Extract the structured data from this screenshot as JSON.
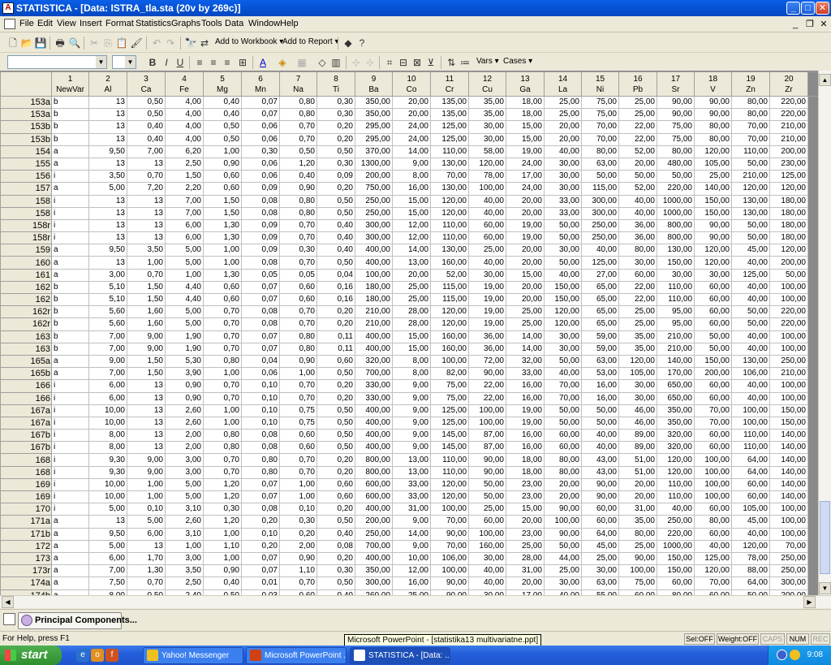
{
  "window": {
    "icon_letter": "A",
    "title": "STATISTICA - [Data: ISTRA_tla.sta (20v by 269c)]",
    "min_glyph": "_",
    "max_glyph": "□",
    "close_glyph": "✕"
  },
  "menu": {
    "items": [
      "File",
      "Edit",
      "View",
      "Insert",
      "Format",
      "Statistics",
      "Graphs",
      "Tools",
      "Data",
      "Window",
      "Help"
    ],
    "mdi_min": "_",
    "mdi_restore": "❐",
    "mdi_close": "✕"
  },
  "toolbar": {
    "add_to_workbook": "Add to Workbook",
    "add_to_report": "Add to Report",
    "vars": "Vars",
    "cases": "Cases",
    "bold": "B",
    "italic": "I",
    "underline": "U"
  },
  "grid": {
    "columns": [
      {
        "num": "1",
        "name": "NewVar"
      },
      {
        "num": "2",
        "name": "Al"
      },
      {
        "num": "3",
        "name": "Ca"
      },
      {
        "num": "4",
        "name": "Fe"
      },
      {
        "num": "5",
        "name": "Mg"
      },
      {
        "num": "6",
        "name": "Mn"
      },
      {
        "num": "7",
        "name": "Na"
      },
      {
        "num": "8",
        "name": "Ti"
      },
      {
        "num": "9",
        "name": "Ba"
      },
      {
        "num": "10",
        "name": "Co"
      },
      {
        "num": "11",
        "name": "Cr"
      },
      {
        "num": "12",
        "name": "Cu"
      },
      {
        "num": "13",
        "name": "Ga"
      },
      {
        "num": "14",
        "name": "La"
      },
      {
        "num": "15",
        "name": "Ni"
      },
      {
        "num": "16",
        "name": "Pb"
      },
      {
        "num": "17",
        "name": "Sr"
      },
      {
        "num": "18",
        "name": "V"
      },
      {
        "num": "19",
        "name": "Zn"
      },
      {
        "num": "20",
        "name": "Zr"
      }
    ],
    "rows": [
      [
        "153a",
        "b",
        "13",
        "0,50",
        "4,00",
        "0,40",
        "0,07",
        "0,80",
        "0,30",
        "350,00",
        "20,00",
        "135,00",
        "35,00",
        "18,00",
        "25,00",
        "75,00",
        "25,00",
        "90,00",
        "90,00",
        "80,00",
        "220,00"
      ],
      [
        "153a",
        "b",
        "13",
        "0,50",
        "4,00",
        "0,40",
        "0,07",
        "0,80",
        "0,30",
        "350,00",
        "20,00",
        "135,00",
        "35,00",
        "18,00",
        "25,00",
        "75,00",
        "25,00",
        "90,00",
        "90,00",
        "80,00",
        "220,00"
      ],
      [
        "153b",
        "b",
        "13",
        "0,40",
        "4,00",
        "0,50",
        "0,06",
        "0,70",
        "0,20",
        "295,00",
        "24,00",
        "125,00",
        "30,00",
        "15,00",
        "20,00",
        "70,00",
        "22,00",
        "75,00",
        "80,00",
        "70,00",
        "210,00"
      ],
      [
        "153b",
        "b",
        "13",
        "0,40",
        "4,00",
        "0,50",
        "0,06",
        "0,70",
        "0,20",
        "295,00",
        "24,00",
        "125,00",
        "30,00",
        "15,00",
        "20,00",
        "70,00",
        "22,00",
        "75,00",
        "80,00",
        "70,00",
        "210,00"
      ],
      [
        "154",
        "a",
        "9,50",
        "7,00",
        "6,20",
        "1,00",
        "0,30",
        "0,50",
        "0,50",
        "370,00",
        "14,00",
        "110,00",
        "58,00",
        "19,00",
        "40,00",
        "80,00",
        "52,00",
        "80,00",
        "120,00",
        "110,00",
        "200,00"
      ],
      [
        "155",
        "a",
        "13",
        "13",
        "2,50",
        "0,90",
        "0,06",
        "1,20",
        "0,30",
        "1300,00",
        "9,00",
        "130,00",
        "120,00",
        "24,00",
        "30,00",
        "63,00",
        "20,00",
        "480,00",
        "105,00",
        "50,00",
        "230,00"
      ],
      [
        "156",
        "i",
        "3,50",
        "0,70",
        "1,50",
        "0,60",
        "0,06",
        "0,40",
        "0,09",
        "200,00",
        "8,00",
        "70,00",
        "78,00",
        "17,00",
        "30,00",
        "50,00",
        "50,00",
        "50,00",
        "25,00",
        "210,00",
        "125,00"
      ],
      [
        "157",
        "a",
        "5,00",
        "7,20",
        "2,20",
        "0,60",
        "0,09",
        "0,90",
        "0,20",
        "750,00",
        "16,00",
        "130,00",
        "100,00",
        "24,00",
        "30,00",
        "115,00",
        "52,00",
        "220,00",
        "140,00",
        "120,00",
        "120,00"
      ],
      [
        "158",
        "i",
        "13",
        "13",
        "7,00",
        "1,50",
        "0,08",
        "0,80",
        "0,50",
        "250,00",
        "15,00",
        "120,00",
        "40,00",
        "20,00",
        "33,00",
        "300,00",
        "40,00",
        "1000,00",
        "150,00",
        "130,00",
        "180,00"
      ],
      [
        "158",
        "i",
        "13",
        "13",
        "7,00",
        "1,50",
        "0,08",
        "0,80",
        "0,50",
        "250,00",
        "15,00",
        "120,00",
        "40,00",
        "20,00",
        "33,00",
        "300,00",
        "40,00",
        "1000,00",
        "150,00",
        "130,00",
        "180,00"
      ],
      [
        "158r",
        "i",
        "13",
        "13",
        "6,00",
        "1,30",
        "0,09",
        "0,70",
        "0,40",
        "300,00",
        "12,00",
        "110,00",
        "60,00",
        "19,00",
        "50,00",
        "250,00",
        "36,00",
        "800,00",
        "90,00",
        "50,00",
        "180,00"
      ],
      [
        "158r",
        "i",
        "13",
        "13",
        "6,00",
        "1,30",
        "0,09",
        "0,70",
        "0,40",
        "300,00",
        "12,00",
        "110,00",
        "60,00",
        "19,00",
        "50,00",
        "250,00",
        "36,00",
        "800,00",
        "90,00",
        "50,00",
        "180,00"
      ],
      [
        "159",
        "a",
        "9,50",
        "3,50",
        "5,00",
        "1,00",
        "0,09",
        "0,30",
        "0,40",
        "400,00",
        "14,00",
        "130,00",
        "25,00",
        "20,00",
        "30,00",
        "40,00",
        "80,00",
        "130,00",
        "120,00",
        "45,00",
        "120,00"
      ],
      [
        "160",
        "a",
        "13",
        "1,00",
        "5,00",
        "1,00",
        "0,08",
        "0,70",
        "0,50",
        "400,00",
        "13,00",
        "160,00",
        "40,00",
        "20,00",
        "50,00",
        "125,00",
        "30,00",
        "150,00",
        "120,00",
        "40,00",
        "200,00"
      ],
      [
        "161",
        "a",
        "3,00",
        "0,70",
        "1,00",
        "1,30",
        "0,05",
        "0,05",
        "0,04",
        "100,00",
        "20,00",
        "52,00",
        "30,00",
        "15,00",
        "40,00",
        "27,00",
        "60,00",
        "30,00",
        "30,00",
        "125,00",
        "50,00"
      ],
      [
        "162",
        "b",
        "5,10",
        "1,50",
        "4,40",
        "0,60",
        "0,07",
        "0,60",
        "0,16",
        "180,00",
        "25,00",
        "115,00",
        "19,00",
        "20,00",
        "150,00",
        "65,00",
        "22,00",
        "110,00",
        "60,00",
        "40,00",
        "100,00"
      ],
      [
        "162",
        "b",
        "5,10",
        "1,50",
        "4,40",
        "0,60",
        "0,07",
        "0,60",
        "0,16",
        "180,00",
        "25,00",
        "115,00",
        "19,00",
        "20,00",
        "150,00",
        "65,00",
        "22,00",
        "110,00",
        "60,00",
        "40,00",
        "100,00"
      ],
      [
        "162r",
        "b",
        "5,60",
        "1,60",
        "5,00",
        "0,70",
        "0,08",
        "0,70",
        "0,20",
        "210,00",
        "28,00",
        "120,00",
        "19,00",
        "25,00",
        "120,00",
        "65,00",
        "25,00",
        "95,00",
        "60,00",
        "50,00",
        "220,00"
      ],
      [
        "162r",
        "b",
        "5,60",
        "1,60",
        "5,00",
        "0,70",
        "0,08",
        "0,70",
        "0,20",
        "210,00",
        "28,00",
        "120,00",
        "19,00",
        "25,00",
        "120,00",
        "65,00",
        "25,00",
        "95,00",
        "60,00",
        "50,00",
        "220,00"
      ],
      [
        "163",
        "b",
        "7,00",
        "9,00",
        "1,90",
        "0,70",
        "0,07",
        "0,80",
        "0,11",
        "400,00",
        "15,00",
        "160,00",
        "36,00",
        "14,00",
        "30,00",
        "59,00",
        "35,00",
        "210,00",
        "50,00",
        "40,00",
        "100,00"
      ],
      [
        "163",
        "b",
        "7,00",
        "9,00",
        "1,90",
        "0,70",
        "0,07",
        "0,80",
        "0,11",
        "400,00",
        "15,00",
        "160,00",
        "36,00",
        "14,00",
        "30,00",
        "59,00",
        "35,00",
        "210,00",
        "50,00",
        "40,00",
        "100,00"
      ],
      [
        "165a",
        "a",
        "9,00",
        "1,50",
        "5,30",
        "0,80",
        "0,04",
        "0,90",
        "0,60",
        "320,00",
        "8,00",
        "100,00",
        "72,00",
        "32,00",
        "50,00",
        "63,00",
        "120,00",
        "140,00",
        "150,00",
        "130,00",
        "250,00"
      ],
      [
        "165b",
        "a",
        "7,00",
        "1,50",
        "3,90",
        "1,00",
        "0,06",
        "1,00",
        "0,50",
        "700,00",
        "8,00",
        "82,00",
        "90,00",
        "33,00",
        "40,00",
        "53,00",
        "105,00",
        "170,00",
        "200,00",
        "106,00",
        "210,00"
      ],
      [
        "166",
        "i",
        "6,00",
        "13",
        "0,90",
        "0,70",
        "0,10",
        "0,70",
        "0,20",
        "330,00",
        "9,00",
        "75,00",
        "22,00",
        "16,00",
        "70,00",
        "16,00",
        "30,00",
        "650,00",
        "60,00",
        "40,00",
        "100,00"
      ],
      [
        "166",
        "i",
        "6,00",
        "13",
        "0,90",
        "0,70",
        "0,10",
        "0,70",
        "0,20",
        "330,00",
        "9,00",
        "75,00",
        "22,00",
        "16,00",
        "70,00",
        "16,00",
        "30,00",
        "650,00",
        "60,00",
        "40,00",
        "100,00"
      ],
      [
        "167a",
        "i",
        "10,00",
        "13",
        "2,60",
        "1,00",
        "0,10",
        "0,75",
        "0,50",
        "400,00",
        "9,00",
        "125,00",
        "100,00",
        "19,00",
        "50,00",
        "50,00",
        "46,00",
        "350,00",
        "70,00",
        "100,00",
        "150,00"
      ],
      [
        "167a",
        "i",
        "10,00",
        "13",
        "2,60",
        "1,00",
        "0,10",
        "0,75",
        "0,50",
        "400,00",
        "9,00",
        "125,00",
        "100,00",
        "19,00",
        "50,00",
        "50,00",
        "46,00",
        "350,00",
        "70,00",
        "100,00",
        "150,00"
      ],
      [
        "167b",
        "i",
        "8,00",
        "13",
        "2,00",
        "0,80",
        "0,08",
        "0,60",
        "0,50",
        "400,00",
        "9,00",
        "145,00",
        "87,00",
        "16,00",
        "60,00",
        "40,00",
        "89,00",
        "320,00",
        "60,00",
        "110,00",
        "140,00"
      ],
      [
        "167b",
        "i",
        "8,00",
        "13",
        "2,00",
        "0,80",
        "0,08",
        "0,60",
        "0,50",
        "400,00",
        "9,00",
        "145,00",
        "87,00",
        "16,00",
        "60,00",
        "40,00",
        "89,00",
        "320,00",
        "60,00",
        "110,00",
        "140,00"
      ],
      [
        "168",
        "i",
        "9,30",
        "9,00",
        "3,00",
        "0,70",
        "0,80",
        "0,70",
        "0,20",
        "800,00",
        "13,00",
        "110,00",
        "90,00",
        "18,00",
        "80,00",
        "43,00",
        "51,00",
        "120,00",
        "100,00",
        "64,00",
        "140,00"
      ],
      [
        "168",
        "i",
        "9,30",
        "9,00",
        "3,00",
        "0,70",
        "0,80",
        "0,70",
        "0,20",
        "800,00",
        "13,00",
        "110,00",
        "90,00",
        "18,00",
        "80,00",
        "43,00",
        "51,00",
        "120,00",
        "100,00",
        "64,00",
        "140,00"
      ],
      [
        "169",
        "i",
        "10,00",
        "1,00",
        "5,00",
        "1,20",
        "0,07",
        "1,00",
        "0,60",
        "600,00",
        "33,00",
        "120,00",
        "50,00",
        "23,00",
        "20,00",
        "90,00",
        "20,00",
        "110,00",
        "100,00",
        "60,00",
        "140,00"
      ],
      [
        "169",
        "i",
        "10,00",
        "1,00",
        "5,00",
        "1,20",
        "0,07",
        "1,00",
        "0,60",
        "600,00",
        "33,00",
        "120,00",
        "50,00",
        "23,00",
        "20,00",
        "90,00",
        "20,00",
        "110,00",
        "100,00",
        "60,00",
        "140,00"
      ],
      [
        "170",
        "i",
        "5,00",
        "0,10",
        "3,10",
        "0,30",
        "0,08",
        "0,10",
        "0,20",
        "400,00",
        "31,00",
        "100,00",
        "25,00",
        "15,00",
        "90,00",
        "60,00",
        "31,00",
        "40,00",
        "60,00",
        "105,00",
        "100,00"
      ],
      [
        "171a",
        "a",
        "13",
        "5,00",
        "2,60",
        "1,20",
        "0,20",
        "0,30",
        "0,50",
        "200,00",
        "9,00",
        "70,00",
        "60,00",
        "20,00",
        "100,00",
        "60,00",
        "35,00",
        "250,00",
        "80,00",
        "45,00",
        "100,00"
      ],
      [
        "171b",
        "a",
        "9,50",
        "6,00",
        "3,10",
        "1,00",
        "0,10",
        "0,20",
        "0,40",
        "250,00",
        "14,00",
        "90,00",
        "100,00",
        "23,00",
        "90,00",
        "64,00",
        "80,00",
        "220,00",
        "60,00",
        "40,00",
        "100,00"
      ],
      [
        "172",
        "a",
        "5,00",
        "13",
        "1,00",
        "1,10",
        "0,20",
        "2,00",
        "0,08",
        "700,00",
        "9,00",
        "70,00",
        "160,00",
        "25,00",
        "50,00",
        "45,00",
        "25,00",
        "1000,00",
        "40,00",
        "120,00",
        "70,00"
      ],
      [
        "173",
        "a",
        "6,00",
        "1,70",
        "3,00",
        "1,00",
        "0,07",
        "0,90",
        "0,20",
        "400,00",
        "10,00",
        "106,00",
        "30,00",
        "28,00",
        "44,00",
        "25,00",
        "90,00",
        "150,00",
        "125,00",
        "78,00",
        "250,00"
      ],
      [
        "173r",
        "a",
        "7,00",
        "1,30",
        "3,50",
        "0,90",
        "0,07",
        "1,10",
        "0,30",
        "350,00",
        "12,00",
        "100,00",
        "40,00",
        "31,00",
        "25,00",
        "30,00",
        "100,00",
        "150,00",
        "120,00",
        "88,00",
        "250,00"
      ],
      [
        "174a",
        "a",
        "7,50",
        "0,70",
        "2,50",
        "0,40",
        "0,01",
        "0,70",
        "0,50",
        "300,00",
        "16,00",
        "90,00",
        "40,00",
        "20,00",
        "30,00",
        "63,00",
        "75,00",
        "60,00",
        "70,00",
        "64,00",
        "300,00"
      ],
      [
        "174b",
        "a",
        "8,00",
        "0,50",
        "2,40",
        "0,50",
        "0,03",
        "0,60",
        "0,40",
        "260,00",
        "25,00",
        "90,00",
        "30,00",
        "17,00",
        "40,00",
        "55,00",
        "60,00",
        "80,00",
        "60,00",
        "50,00",
        "200,00"
      ]
    ]
  },
  "workbook_bar": {
    "button_label": "Principal Components..."
  },
  "status": {
    "help_text": "For Help, press F1",
    "tooltip": "Microsoft PowerPoint - [statistika13 multivariatne.ppt]",
    "panes": [
      "Sel:OFF",
      "Weight:OFF",
      "CAPS",
      "NUM",
      "REC"
    ]
  },
  "taskbar": {
    "start": "start",
    "tasks": [
      {
        "label": "Yahoo! Messenger"
      },
      {
        "label": "Microsoft PowerPoint ..."
      },
      {
        "label": "STATISTICA - [Data: ..."
      }
    ],
    "clock": "9:08"
  },
  "colors": {
    "title_blue": "#0553d4",
    "taskbar_blue": "#245edb",
    "start_green": "#3c9c3c",
    "grid_gray_column": "#8a8a8a"
  }
}
